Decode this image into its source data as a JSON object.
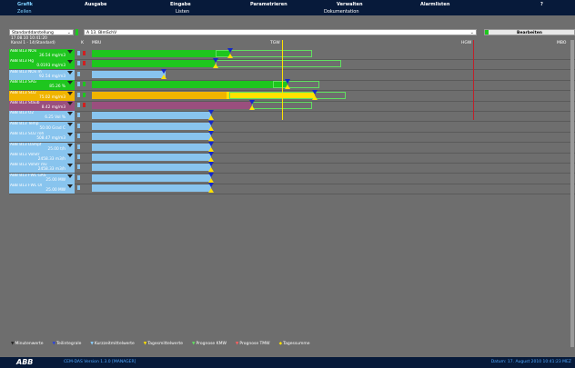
{
  "menu": {
    "top": [
      "Grafik",
      "Ausgabe",
      "Eingabe",
      "Parametrieren",
      "Verwalten",
      "Alarmlisten",
      "?"
    ],
    "sub": [
      "Zeilen",
      "Listen",
      "Dokumentation"
    ]
  },
  "toolbar": {
    "view_select": "Standarddarstellung",
    "reg_select": "A 13. BImSchV",
    "edit_button": "Bearbeiten"
  },
  "header": {
    "datetime": "17.08.10 10:41:20",
    "channel": "Kanal 1 - 14(Standard)",
    "k_label": "K",
    "mbu_label": "MBU",
    "tgw_label": "TGW",
    "hgw_label": "HGW",
    "mbo_label": "MBO"
  },
  "rows": [
    {
      "name": "ABB  B13  NOx",
      "value": "36.54  mg/m3",
      "bg": "#1ec61e"
    },
    {
      "name": "ABB  B13  Hg",
      "value": "0.0193  mg/m3",
      "bg": "#1ec61e"
    },
    {
      "name": "ABB  B13  NOx m",
      "value": "92.54  mg/m3",
      "bg": "#88c4ee"
    },
    {
      "name": "ABB  B13  SAG",
      "value": "85.26  %",
      "bg": "#1ec61e"
    },
    {
      "name": "ABB  B13  SO2",
      "value": "75.02  mg/m3",
      "bg": "#f0b400"
    },
    {
      "name": "ABB  B13  Staub",
      "value": "8.42  mg/m3",
      "bg": "#9a4f7e"
    },
    {
      "name": "ABB  B13  O2",
      "value": "6.25  Vol %",
      "bg": "#88c4ee"
    },
    {
      "name": "ABB  B13  Temp",
      "value": "50.00  Grad C",
      "bg": "#88c4ee"
    },
    {
      "name": "ABB  B13  SO2 roh",
      "value": "508.47  mg/m3",
      "bg": "#88c4ee"
    },
    {
      "name": "ABB  B13  Dampf",
      "value": "25.00  t/h",
      "bg": "#88c4ee"
    },
    {
      "name": "ABB  B13  VolStr",
      "value": "2458.33  m3/h",
      "bg": "#88c4ee"
    },
    {
      "name": "ABB  B13  VolStr mv",
      "value": "2458.33  m3/h",
      "bg": "#88c4ee"
    },
    {
      "name": "ABB  B13  FWL GAS",
      "value": "25.00  MW",
      "bg": "#88c4ee"
    },
    {
      "name": "ABB  B13  FWL Öl",
      "value": "25.00  MW",
      "bg": "#88c4ee"
    }
  ],
  "legend": [
    {
      "symbol": "▼",
      "color": "#222222",
      "label": "Minutenwerte"
    },
    {
      "symbol": "▼",
      "color": "#2840e0",
      "label": "Teilintegrale"
    },
    {
      "symbol": "▼",
      "color": "#8ad0ff",
      "label": "Kurzzeitmittelwerte"
    },
    {
      "symbol": "▼",
      "color": "#ffe200",
      "label": "Tagesmittelwerte"
    },
    {
      "symbol": "▼",
      "color": "#60e060",
      "label": "Prognose KMW"
    },
    {
      "symbol": "▼",
      "color": "#ff6060",
      "label": "Prognose TMW"
    },
    {
      "symbol": "◆",
      "color": "#ffe200",
      "label": "Tagessumme"
    }
  ],
  "status": {
    "logo": "ABB",
    "version": "CEM-DAS   Version  1.3.0  [MANAGER]",
    "datetime": "Datum:  17. August 2010 10:41:23 MEZ"
  },
  "colors": {
    "menu_bg": "#071a3a",
    "panel_bg": "#676767",
    "bar_green": "#1ec61e",
    "bar_blue": "#88c4ee",
    "bar_yellow": "#f0b400",
    "bar_purple": "#9a4f7e"
  }
}
